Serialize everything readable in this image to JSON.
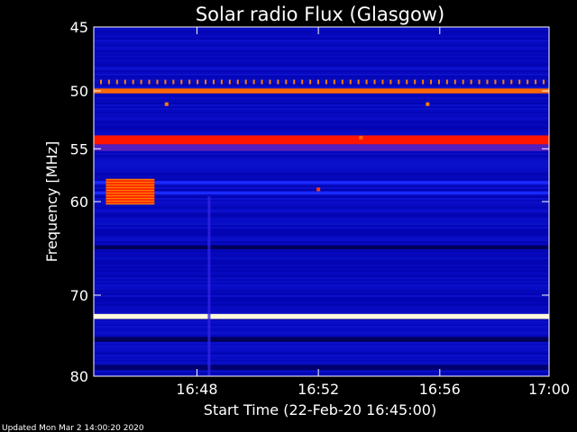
{
  "chart_data": {
    "type": "heatmap",
    "title": "Solar radio Flux (Glasgow)",
    "xlabel": "Start Time (22-Feb-20 16:45:00)",
    "ylabel": "Frequency [MHz]",
    "x_unit": "minutes after 16:45:00",
    "xlim": [
      0,
      15
    ],
    "ylim": [
      45,
      80
    ],
    "y_log_scale": true,
    "y_inverted": true,
    "x_ticks": [
      {
        "value": 3.4,
        "label": "16:48"
      },
      {
        "value": 7.4,
        "label": "16:52"
      },
      {
        "value": 11.4,
        "label": "16:56"
      },
      {
        "value": 15.0,
        "label": "17:00"
      }
    ],
    "y_ticks": [
      {
        "value": 45,
        "label": "45"
      },
      {
        "value": 50,
        "label": "50"
      },
      {
        "value": 55,
        "label": "55"
      },
      {
        "value": 60,
        "label": "60"
      },
      {
        "value": 70,
        "label": "70"
      },
      {
        "value": 80,
        "label": "80"
      }
    ],
    "colormap": [
      "#000033",
      "#0000aa",
      "#1a2aff",
      "#ff0000",
      "#ffd000",
      "#ffffff"
    ],
    "background_level": 0.25,
    "horizontal_bands": [
      {
        "freq_from": 49.8,
        "freq_to": 50.2,
        "level": 0.7
      },
      {
        "freq_from": 53.8,
        "freq_to": 54.6,
        "level": 0.62
      },
      {
        "freq_from": 54.6,
        "freq_to": 55.2,
        "level": 0.45
      },
      {
        "freq_from": 58.0,
        "freq_to": 58.3,
        "level": 0.4
      },
      {
        "freq_from": 59.0,
        "freq_to": 59.3,
        "level": 0.4
      },
      {
        "freq_from": 64.5,
        "freq_to": 64.9,
        "level": 0.06
      },
      {
        "freq_from": 72.2,
        "freq_to": 72.8,
        "level": 0.97
      },
      {
        "freq_from": 75.0,
        "freq_to": 75.6,
        "level": 0.06
      },
      {
        "freq_from": 78.5,
        "freq_to": 79.2,
        "level": 0.1
      }
    ],
    "bursts": [
      {
        "t_from": 0.4,
        "t_to": 2.0,
        "freq_from": 57.8,
        "freq_to": 60.2,
        "level": 0.72
      }
    ],
    "vertical_streaks": [
      {
        "t": 3.8,
        "freq_from": 59.5,
        "freq_to": 80,
        "level": 0.42
      }
    ],
    "spikes": [
      {
        "t": 2.4,
        "freq": 51.1,
        "level": 0.72
      },
      {
        "t": 11.0,
        "freq": 51.1,
        "level": 0.72
      },
      {
        "t": 8.8,
        "freq": 54.0,
        "level": 0.7
      },
      {
        "t": 7.4,
        "freq": 58.8,
        "level": 0.66
      }
    ],
    "interference_line": {
      "freq": 49.3,
      "count": 56,
      "level": 0.72
    }
  },
  "footer": {
    "updated": "Updated Mon Mar  2 14:00:20 2020"
  }
}
